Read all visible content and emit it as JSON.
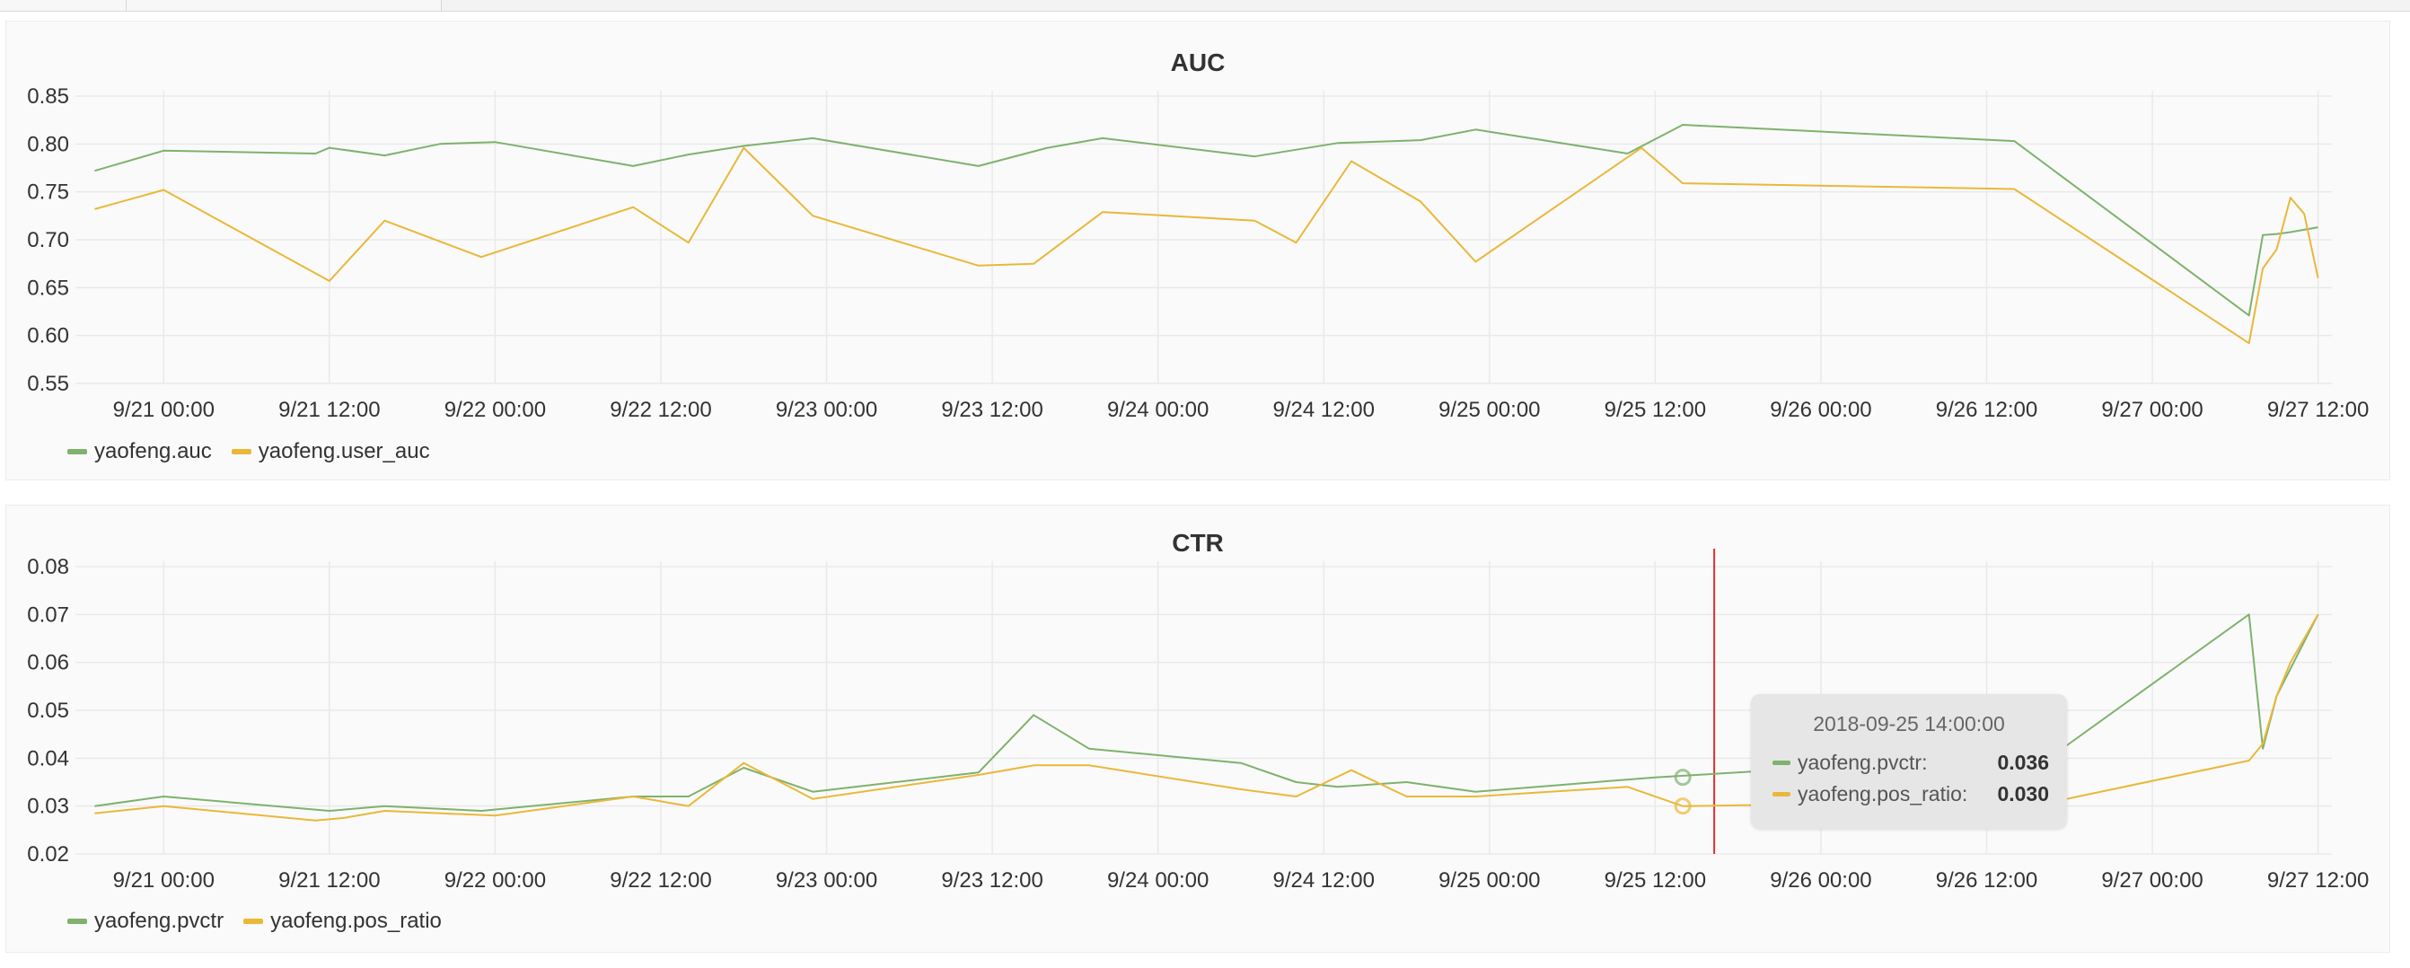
{
  "colors": {
    "green": "#7eb26d",
    "yellow": "#eab839",
    "cursor": "#e02f2f",
    "grid": "#e9e9e9"
  },
  "chart_data": [
    {
      "type": "line",
      "title": "AUC",
      "xlabel": "",
      "ylabel": "",
      "ylim": [
        0.55,
        0.85
      ],
      "xlim": [
        "2018-09-20 18:00",
        "2018-09-27 13:00"
      ],
      "yticks": [
        "0.55",
        "0.60",
        "0.65",
        "0.70",
        "0.75",
        "0.80",
        "0.85"
      ],
      "xticks": [
        "9/21 00:00",
        "9/21 12:00",
        "9/22 00:00",
        "9/22 12:00",
        "9/23 00:00",
        "9/23 12:00",
        "9/24 00:00",
        "9/24 12:00",
        "9/25 00:00",
        "9/25 12:00",
        "9/26 00:00",
        "9/26 12:00",
        "9/27 00:00",
        "9/27 12:00"
      ],
      "grid": true,
      "legend": "bottom-left",
      "series": [
        {
          "name": "yaofeng.auc",
          "color": "#7eb26d",
          "points": [
            [
              "2018-09-20 19:00",
              0.772
            ],
            [
              "2018-09-21 00:00",
              0.793
            ],
            [
              "2018-09-21 11:00",
              0.79
            ],
            [
              "2018-09-21 12:00",
              0.796
            ],
            [
              "2018-09-21 16:00",
              0.788
            ],
            [
              "2018-09-21 20:00",
              0.8
            ],
            [
              "2018-09-22 00:00",
              0.802
            ],
            [
              "2018-09-22 10:00",
              0.777
            ],
            [
              "2018-09-22 14:00",
              0.789
            ],
            [
              "2018-09-22 18:00",
              0.798
            ],
            [
              "2018-09-22 23:00",
              0.806
            ],
            [
              "2018-09-23 11:00",
              0.777
            ],
            [
              "2018-09-23 16:00",
              0.796
            ],
            [
              "2018-09-23 20:00",
              0.806
            ],
            [
              "2018-09-24 07:00",
              0.787
            ],
            [
              "2018-09-24 13:00",
              0.801
            ],
            [
              "2018-09-24 19:00",
              0.804
            ],
            [
              "2018-09-24 23:00",
              0.815
            ],
            [
              "2018-09-25 10:00",
              0.79
            ],
            [
              "2018-09-25 14:00",
              0.82
            ],
            [
              "2018-09-26 14:00",
              0.803
            ],
            [
              "2018-09-27 07:00",
              0.621
            ],
            [
              "2018-09-27 08:00",
              0.705
            ],
            [
              "2018-09-27 09:00",
              0.706
            ],
            [
              "2018-09-27 10:00",
              0.708
            ],
            [
              "2018-09-27 12:00",
              0.713
            ]
          ]
        },
        {
          "name": "yaofeng.user_auc",
          "color": "#eab839",
          "points": [
            [
              "2018-09-20 19:00",
              0.732
            ],
            [
              "2018-09-21 00:00",
              0.752
            ],
            [
              "2018-09-21 12:00",
              0.657
            ],
            [
              "2018-09-21 16:00",
              0.72
            ],
            [
              "2018-09-21 23:00",
              0.682
            ],
            [
              "2018-09-22 10:00",
              0.734
            ],
            [
              "2018-09-22 14:00",
              0.697
            ],
            [
              "2018-09-22 18:00",
              0.796
            ],
            [
              "2018-09-22 23:00",
              0.725
            ],
            [
              "2018-09-23 11:00",
              0.673
            ],
            [
              "2018-09-23 15:00",
              0.675
            ],
            [
              "2018-09-23 20:00",
              0.729
            ],
            [
              "2018-09-24 07:00",
              0.72
            ],
            [
              "2018-09-24 10:00",
              0.697
            ],
            [
              "2018-09-24 14:00",
              0.782
            ],
            [
              "2018-09-24 19:00",
              0.74
            ],
            [
              "2018-09-24 23:00",
              0.677
            ],
            [
              "2018-09-25 11:00",
              0.796
            ],
            [
              "2018-09-25 14:00",
              0.759
            ],
            [
              "2018-09-26 14:00",
              0.753
            ],
            [
              "2018-09-27 07:00",
              0.592
            ],
            [
              "2018-09-27 08:00",
              0.67
            ],
            [
              "2018-09-27 09:00",
              0.69
            ],
            [
              "2018-09-27 10:00",
              0.744
            ],
            [
              "2018-09-27 11:00",
              0.727
            ],
            [
              "2018-09-27 12:00",
              0.66
            ]
          ]
        }
      ]
    },
    {
      "type": "line",
      "title": "CTR",
      "xlabel": "",
      "ylabel": "",
      "ylim": [
        0.02,
        0.08
      ],
      "xlim": [
        "2018-09-20 18:00",
        "2018-09-27 13:00"
      ],
      "yticks": [
        "0.02",
        "0.03",
        "0.04",
        "0.05",
        "0.06",
        "0.07",
        "0.08"
      ],
      "xticks": [
        "9/21 00:00",
        "9/21 12:00",
        "9/22 00:00",
        "9/22 12:00",
        "9/23 00:00",
        "9/23 12:00",
        "9/24 00:00",
        "9/24 12:00",
        "9/25 00:00",
        "9/25 12:00",
        "9/26 00:00",
        "9/26 12:00",
        "9/27 00:00",
        "9/27 12:00"
      ],
      "grid": true,
      "legend": "bottom-left",
      "cursor_time": "2018-09-25 14:00",
      "series": [
        {
          "name": "yaofeng.pvctr",
          "color": "#7eb26d",
          "points": [
            [
              "2018-09-20 19:00",
              0.03
            ],
            [
              "2018-09-21 00:00",
              0.032
            ],
            [
              "2018-09-21 12:00",
              0.029
            ],
            [
              "2018-09-21 16:00",
              0.03
            ],
            [
              "2018-09-21 23:00",
              0.029
            ],
            [
              "2018-09-22 10:00",
              0.032
            ],
            [
              "2018-09-22 14:00",
              0.032
            ],
            [
              "2018-09-22 18:00",
              0.038
            ],
            [
              "2018-09-22 23:00",
              0.033
            ],
            [
              "2018-09-23 11:00",
              0.037
            ],
            [
              "2018-09-23 15:00",
              0.049
            ],
            [
              "2018-09-23 19:00",
              0.042
            ],
            [
              "2018-09-24 06:00",
              0.039
            ],
            [
              "2018-09-24 10:00",
              0.035
            ],
            [
              "2018-09-24 13:00",
              0.034
            ],
            [
              "2018-09-24 18:00",
              0.035
            ],
            [
              "2018-09-24 23:00",
              0.033
            ],
            [
              "2018-09-25 12:00",
              0.036
            ],
            [
              "2018-09-26 17:00",
              0.041
            ],
            [
              "2018-09-27 07:00",
              0.07
            ],
            [
              "2018-09-27 08:00",
              0.042
            ],
            [
              "2018-09-27 09:00",
              0.053
            ],
            [
              "2018-09-27 12:00",
              0.07
            ]
          ]
        },
        {
          "name": "yaofeng.pos_ratio",
          "color": "#eab839",
          "points": [
            [
              "2018-09-20 19:00",
              0.0285
            ],
            [
              "2018-09-21 00:00",
              0.03
            ],
            [
              "2018-09-21 11:00",
              0.027
            ],
            [
              "2018-09-21 13:00",
              0.0275
            ],
            [
              "2018-09-21 16:00",
              0.029
            ],
            [
              "2018-09-22 00:00",
              0.028
            ],
            [
              "2018-09-22 10:00",
              0.032
            ],
            [
              "2018-09-22 14:00",
              0.03
            ],
            [
              "2018-09-22 18:00",
              0.039
            ],
            [
              "2018-09-22 23:00",
              0.0315
            ],
            [
              "2018-09-23 11:00",
              0.0365
            ],
            [
              "2018-09-23 15:00",
              0.0385
            ],
            [
              "2018-09-23 19:00",
              0.0385
            ],
            [
              "2018-09-24 06:00",
              0.0335
            ],
            [
              "2018-09-24 10:00",
              0.032
            ],
            [
              "2018-09-24 14:00",
              0.0375
            ],
            [
              "2018-09-24 18:00",
              0.032
            ],
            [
              "2018-09-24 23:00",
              0.032
            ],
            [
              "2018-09-25 10:00",
              0.034
            ],
            [
              "2018-09-25 14:00",
              0.03
            ],
            [
              "2018-09-26 17:00",
              0.031
            ],
            [
              "2018-09-27 07:00",
              0.0395
            ],
            [
              "2018-09-27 08:00",
              0.043
            ],
            [
              "2018-09-27 09:00",
              0.053
            ],
            [
              "2018-09-27 10:00",
              0.06
            ],
            [
              "2018-09-27 12:00",
              0.07
            ]
          ]
        }
      ],
      "tooltip": {
        "time": "2018-09-25 14:00:00",
        "rows": [
          {
            "label": "yaofeng.pvctr:",
            "value": "0.036",
            "color": "#7eb26d"
          },
          {
            "label": "yaofeng.pos_ratio:",
            "value": "0.030",
            "color": "#eab839"
          }
        ]
      }
    }
  ]
}
